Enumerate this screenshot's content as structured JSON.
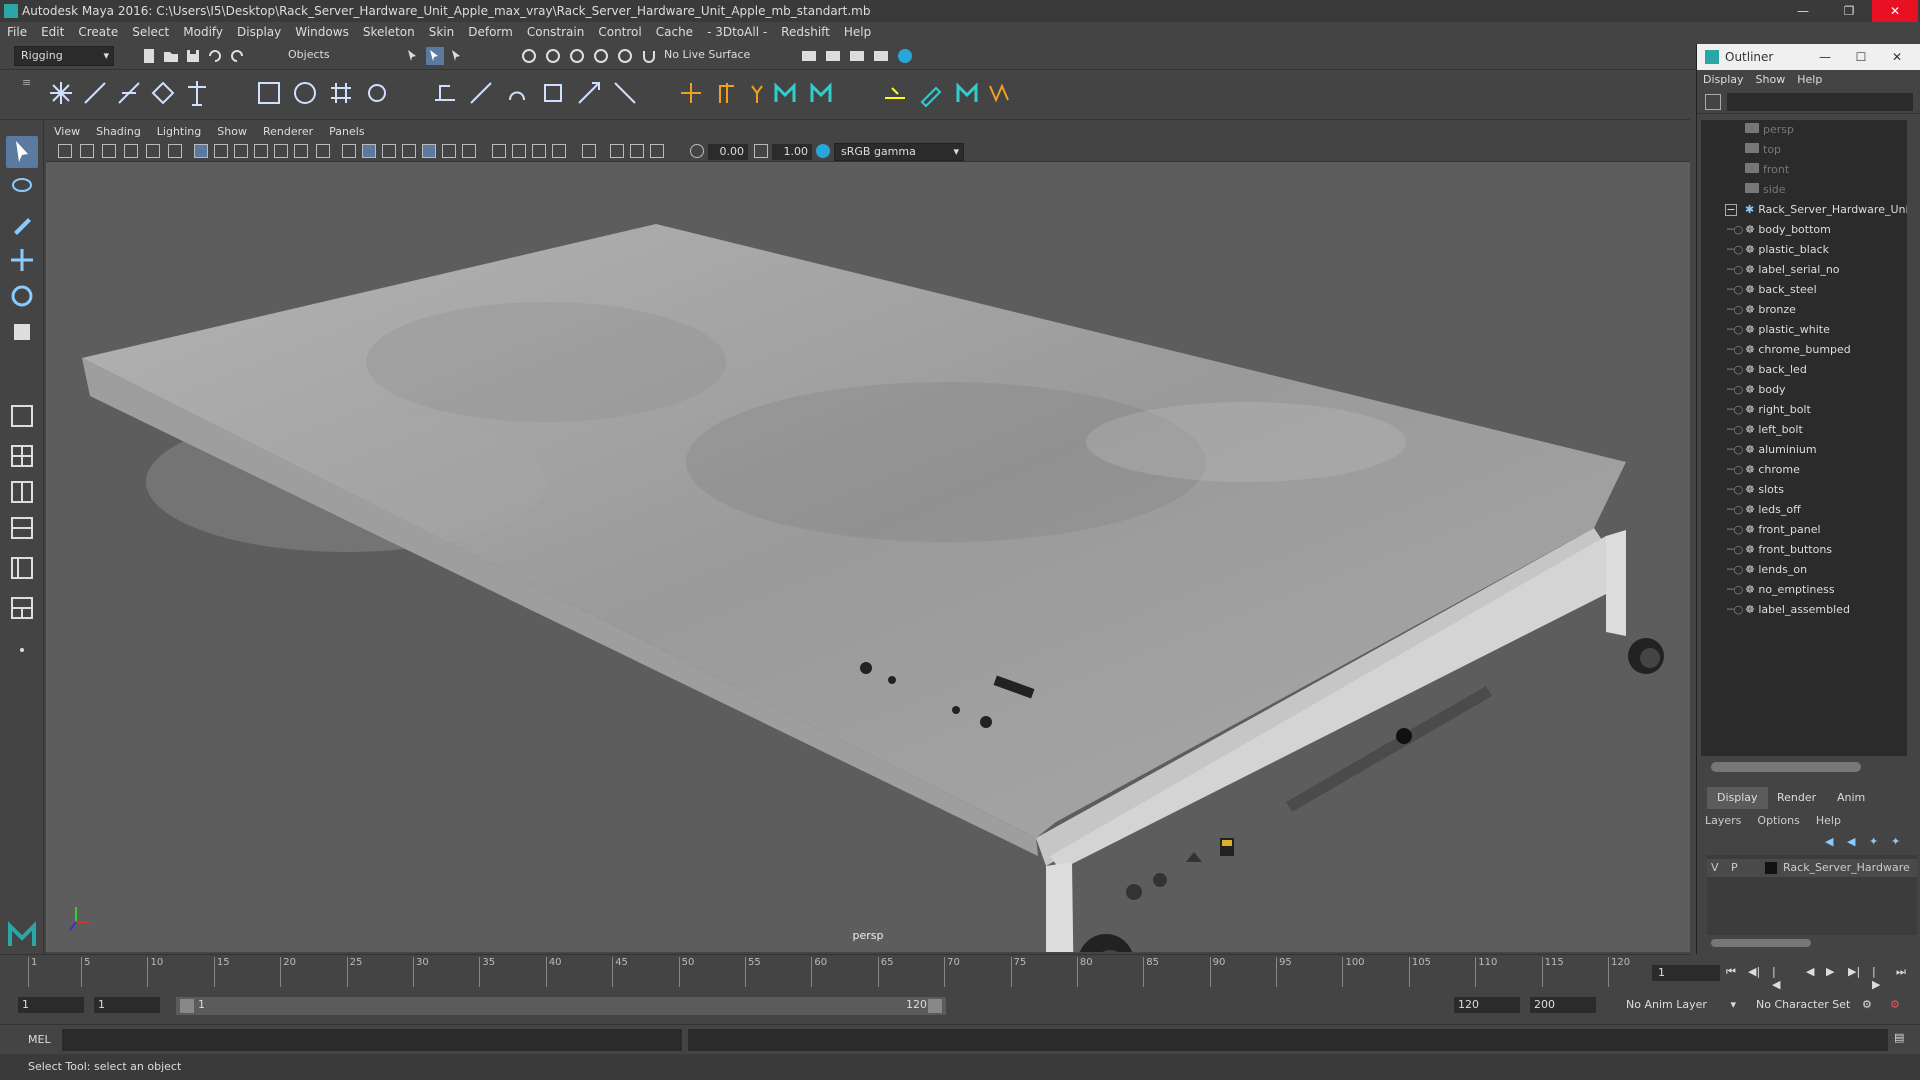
{
  "window": {
    "title": "Autodesk Maya 2016: C:\\Users\\I5\\Desktop\\Rack_Server_Hardware_Unit_Apple_max_vray\\Rack_Server_Hardware_Unit_Apple_mb_standart.mb"
  },
  "menubar": [
    "File",
    "Edit",
    "Create",
    "Select",
    "Modify",
    "Display",
    "Windows",
    "Skeleton",
    "Skin",
    "Deform",
    "Constrain",
    "Control",
    "Cache",
    "- 3DtoAll -",
    "Redshift",
    "Help"
  ],
  "statusline": {
    "menuset": "Rigging",
    "selection_mode": "Objects",
    "live_surface": "No Live Surface"
  },
  "panel": {
    "menu": [
      "View",
      "Shading",
      "Lighting",
      "Show",
      "Renderer",
      "Panels"
    ],
    "exposure": "0.00",
    "gamma": "1.00",
    "color_space": "sRGB gamma",
    "camera_label": "persp"
  },
  "timeslider": {
    "ticks": [
      "1",
      "5",
      "10",
      "15",
      "20",
      "25",
      "30",
      "35",
      "40",
      "45",
      "50",
      "55",
      "60",
      "65",
      "70",
      "75",
      "80",
      "85",
      "90",
      "95",
      "100",
      "105",
      "110",
      "115",
      "120"
    ],
    "current_frame": "1"
  },
  "rangeslider": {
    "start": "1",
    "playback_start": "1",
    "range_start_label": "1",
    "range_end_label": "120",
    "playback_end": "120",
    "end": "200",
    "anim_layer": "No Anim Layer",
    "character_set": "No Character Set"
  },
  "cmdline": {
    "label": "MEL"
  },
  "helpline": {
    "text": "Select Tool: select an object"
  },
  "outliner": {
    "title": "Outliner",
    "menu": [
      "Display",
      "Show",
      "Help"
    ],
    "cameras": [
      "persp",
      "top",
      "front",
      "side"
    ],
    "group": "Rack_Server_Hardware_Unit_",
    "children": [
      "body_bottom",
      "plastic_black",
      "label_serial_no",
      "back_steel",
      "bronze",
      "plastic_white",
      "chrome_bumped",
      "back_led",
      "body",
      "right_bolt",
      "left_bolt",
      "aluminium",
      "chrome",
      "slots",
      "leds_off",
      "front_panel",
      "front_buttons",
      "lends_on",
      "no_emptiness",
      "label_assembled"
    ]
  },
  "layer_editor": {
    "tabs": [
      "Display",
      "Render",
      "Anim"
    ],
    "menu": [
      "Layers",
      "Options",
      "Help"
    ],
    "layer": {
      "v": "V",
      "p": "P",
      "name": "Rack_Server_Hardware"
    }
  }
}
